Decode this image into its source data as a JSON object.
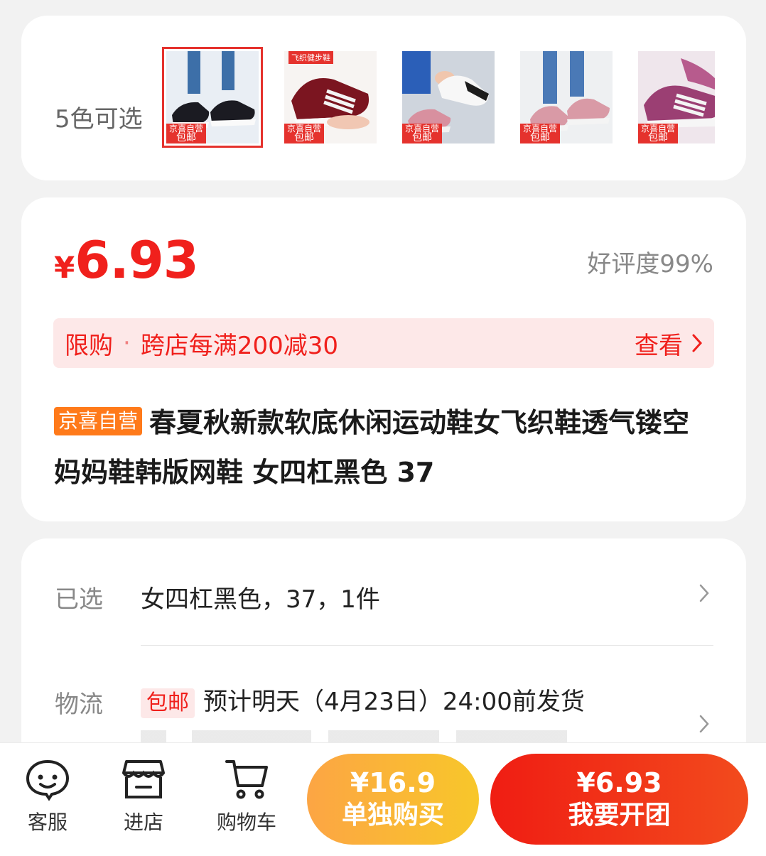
{
  "colors": {
    "label": "5色可选",
    "thumbs": [
      {
        "id": "black",
        "tag_top": "京喜自营",
        "tag_bottom": "包邮",
        "ribbon": ""
      },
      {
        "id": "burgundy",
        "tag_top": "京喜自营",
        "tag_bottom": "包邮",
        "ribbon": "飞织健步鞋"
      },
      {
        "id": "pink-white",
        "tag_top": "京喜自营",
        "tag_bottom": "包邮",
        "ribbon": ""
      },
      {
        "id": "pink",
        "tag_top": "京喜自营",
        "tag_bottom": "包邮",
        "ribbon": ""
      },
      {
        "id": "purple",
        "tag_top": "京喜自营",
        "tag_bottom": "包邮",
        "ribbon": ""
      }
    ]
  },
  "price": {
    "symbol": "¥",
    "value": "6.93",
    "rating": "好评度99%"
  },
  "promo": {
    "limit": "限购",
    "dot": "·",
    "discount": "跨店每满200减30",
    "view": "查看"
  },
  "product": {
    "badge": "京喜自营",
    "title": "春夏秋新款软底休闲运动鞋女飞织鞋透气镂空妈妈鞋韩版网鞋 女四杠黑色 37"
  },
  "info": {
    "selected_label": "已选",
    "selected_value": "女四杠黑色，37，1件",
    "shipping_label": "物流",
    "shipping_tag": "包邮",
    "shipping_value": "预计明天（4月23日）24:00前发货"
  },
  "bottom": {
    "service": "客服",
    "store": "进店",
    "cart": "购物车",
    "single_price": "¥16.9",
    "single_label": "单独购买",
    "group_price": "¥6.93",
    "group_label": "我要开团"
  },
  "theme": {
    "red": "#f0201c",
    "orange": "#ff7a1a"
  }
}
